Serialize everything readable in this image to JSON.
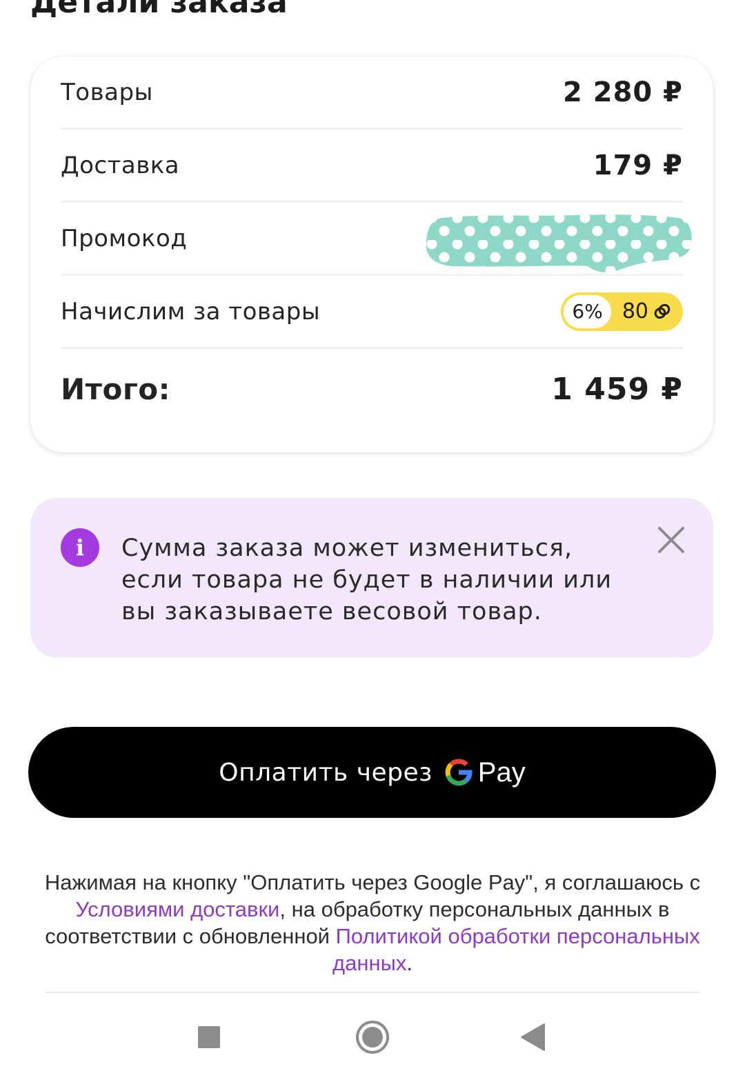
{
  "header": {
    "title": "Детали заказа"
  },
  "summary": {
    "rows": [
      {
        "label": "Товары",
        "value": "2 280 ₽"
      },
      {
        "label": "Доставка",
        "value": "179 ₽"
      },
      {
        "label": "Промокод",
        "value": ""
      },
      {
        "label": "Начислим за товары",
        "bonus_percent": "6%",
        "bonus_amount": "80"
      }
    ],
    "total_label": "Итого:",
    "total_value": "1 459 ₽"
  },
  "notice": {
    "line1": "Сумма заказа может измениться,",
    "line2": "если товара не будет в наличии или",
    "line3": "вы заказываете весовой товар.",
    "icon": "info-icon",
    "close_icon": "close-icon"
  },
  "pay_button": {
    "label": "Оплатить через",
    "brand": "Pay",
    "logo": "google-g-icon"
  },
  "legal": {
    "part1": "Нажимая на кнопку \"Оплатить через Google Pay\", я соглашаюсь с ",
    "link1": "Условиями доставки",
    "part2": ", на обработку персональных данных в соответствии с обновленной ",
    "link2": "Политикой обработки персональных данных",
    "part3": "."
  },
  "colors": {
    "accent_purple": "#a53ae0",
    "link_purple": "#8e3bbf",
    "notice_bg": "#f3e7fb",
    "bonus_yellow": "#f9dc4b",
    "redaction_teal": "#8fd8c8"
  },
  "nav": {
    "icons": [
      "recents-square-icon",
      "home-circle-icon",
      "back-triangle-icon"
    ]
  }
}
